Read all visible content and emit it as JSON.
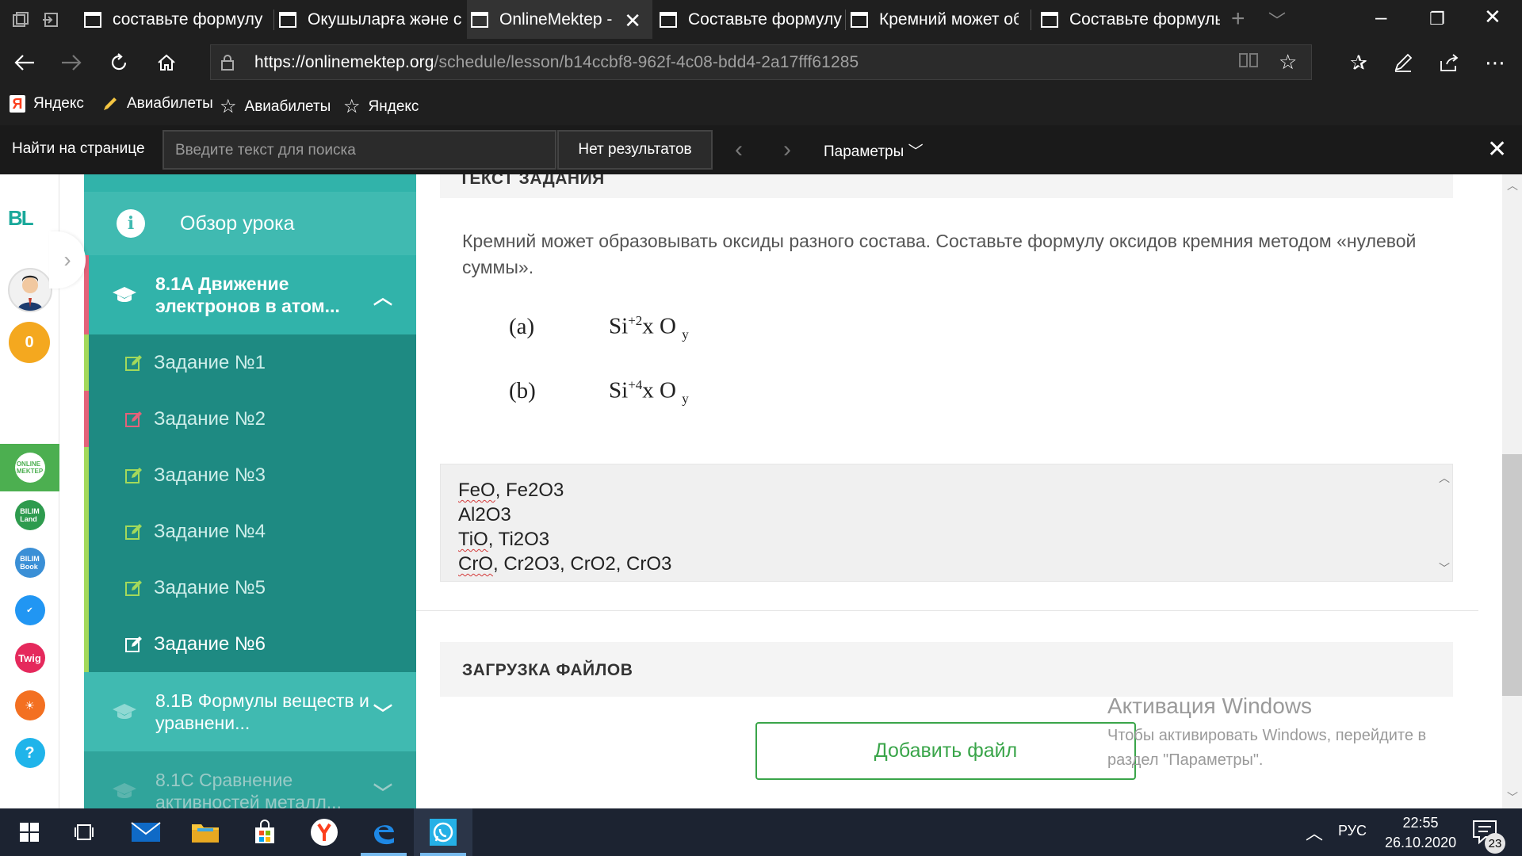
{
  "browser": {
    "tabs": [
      {
        "label": "составьте формулу"
      },
      {
        "label": "Окушыларға және с"
      },
      {
        "label": "OnlineMektep -",
        "active": true
      },
      {
        "label": "Составьте формулу"
      },
      {
        "label": "Кремний может обр"
      },
      {
        "label": "Составьте формулы"
      }
    ],
    "url_host": "https://onlinemektep.org",
    "url_path": "/schedule/lesson/b14ccbf8-962f-4c08-bdd4-2a17fff61285",
    "favorites": [
      "Яндекс",
      "Авиабилеты",
      "Авиабилеты",
      "Яндекс"
    ],
    "find": {
      "label": "Найти на странице",
      "placeholder": "Введите текст для поиска",
      "result": "Нет результатов",
      "params": "Параметры"
    }
  },
  "rail": {
    "logo": "BL",
    "coins": "0",
    "apps": [
      "OnlineMektep",
      "BILIM Land",
      "BILIM Book",
      "iTest",
      "Twig",
      "iMektep",
      "Help"
    ]
  },
  "lesson_sidebar": {
    "overview": "Обзор урока",
    "sections": [
      {
        "title": "8.1A Движение электронов в атом..."
      },
      {
        "title": "8.1B Формулы веществ и уравнени..."
      },
      {
        "title": "8.1C Сравнение активностей металл..."
      }
    ],
    "tasks": [
      "Задание №1",
      "Задание №2",
      "Задание №3",
      "Задание №4",
      "Задание №5",
      "Задание №6"
    ]
  },
  "main": {
    "task_header": "ТЕКСТ ЗАДАНИЯ",
    "task_text": "Кремний может образовывать оксиды разного состава. Составьте формулу оксидов кремния методом «нулевой суммы».",
    "formulas": [
      {
        "label": "(a)",
        "el": "Si",
        "charge": "+2",
        "x": "x O",
        "y": "y"
      },
      {
        "label": "(b)",
        "el": "Si",
        "charge": "+4",
        "x": "x O",
        "y": "y"
      }
    ],
    "answer_lines": [
      {
        "a": "FeO",
        "b": ", Fe2O3"
      },
      {
        "a": "",
        "b": "Al2O3"
      },
      {
        "a": "TiO",
        "b": ", Ti2O3"
      },
      {
        "a": "CrO",
        "b": ", Cr2O3, CrO2, CrO3"
      }
    ],
    "upload_header": "ЗАГРУЗКА ФАЙЛОВ",
    "add_file": "Добавить файл"
  },
  "watermark": {
    "title": "Активация Windows",
    "text": "Чтобы активировать Windows, перейдите в раздел \"Параметры\"."
  },
  "taskbar": {
    "lang": "РУС",
    "time": "22:55",
    "date": "26.10.2020",
    "notifications": "23"
  },
  "colors": {
    "accent_teal": "#1e8a82",
    "sidebar_light": "#40bab1",
    "active_red": "#e4627a",
    "done_green": "#a3d95b",
    "button_green": "#3aa54a",
    "coin_orange": "#f4a81f"
  }
}
